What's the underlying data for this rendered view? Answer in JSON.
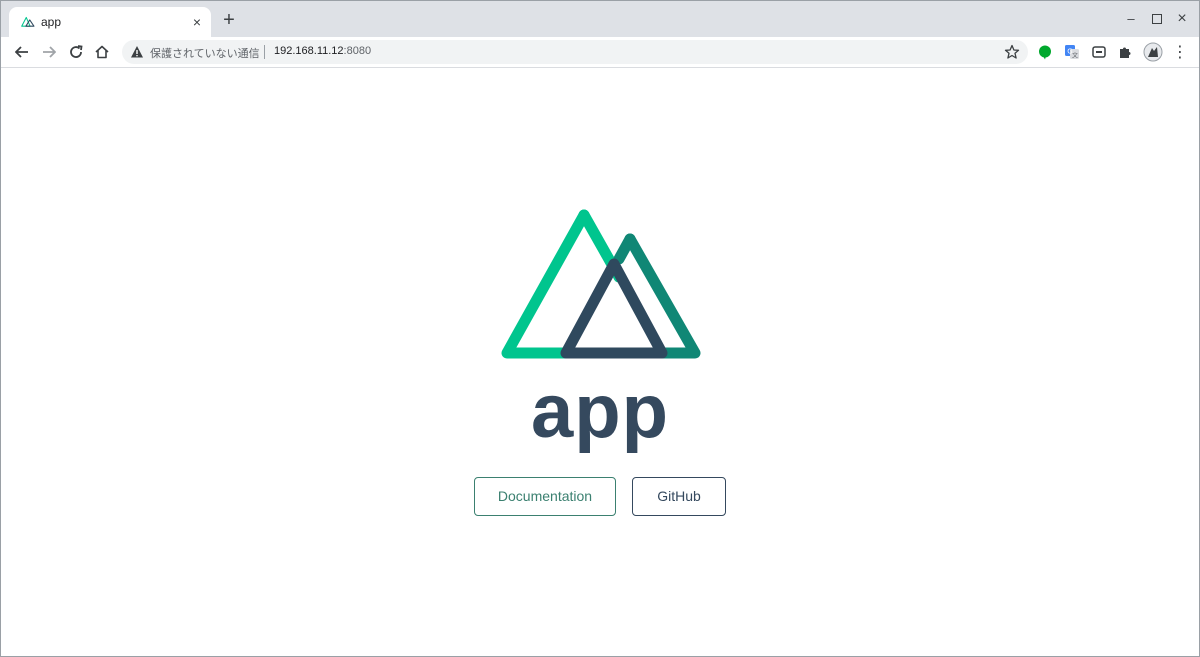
{
  "browser": {
    "tab": {
      "title": "app",
      "close_glyph": "×"
    },
    "new_tab_glyph": "+",
    "window_controls": {
      "minimize": "–",
      "maximize": "□",
      "close": "×"
    },
    "address_bar": {
      "security_label": "保護されていない通信",
      "url_host": "192.168.11.12",
      "url_port": ":8080"
    },
    "menu_glyph": "⋮"
  },
  "page": {
    "title": "app",
    "buttons": {
      "documentation": "Documentation",
      "github": "GitHub"
    }
  },
  "colors": {
    "nuxt_green": "#00c58e",
    "nuxt_dark_green": "#108775",
    "nuxt_navy": "#2f495e",
    "title_color": "#35495e",
    "doc_button": "#3b8070"
  },
  "icons": [
    "nuxt-logo-icon",
    "back-arrow-icon",
    "forward-arrow-icon",
    "reload-icon",
    "home-icon",
    "warning-icon",
    "star-icon",
    "extension-green-icon",
    "translate-icon",
    "cast-icon",
    "puzzle-icon",
    "profile-avatar-icon",
    "menu-icon"
  ]
}
